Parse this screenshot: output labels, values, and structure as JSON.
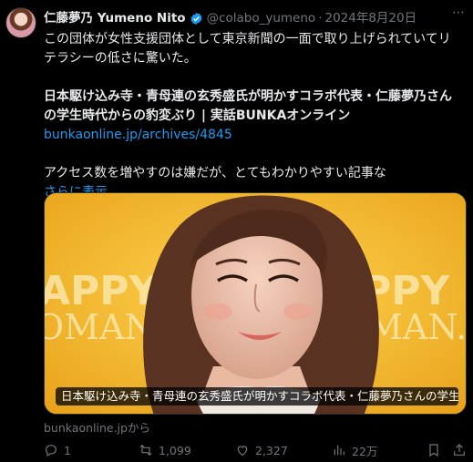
{
  "author": {
    "display_name": "仁藤夢乃 Yumeno Nito",
    "handle": "@colabo_yumeno",
    "separator": "·",
    "date": "2024年8月20日"
  },
  "post": {
    "line1": "この団体が女性支援団体として東京新聞の一面で取り上げられていてリテラシーの低さに驚いた。",
    "headline": "日本駆け込み寺・青母連の玄秀盛氏が明かすコラボ代表・仁藤夢乃さんの学生時代からの豹変ぶり | 実話BUNKAオンライン",
    "link": "bunkaonline.jp/archives/4845",
    "line2": "アクセス数を増やすのは嫌だが、とてもわかりやすい記事な",
    "show_more": "さらに表示"
  },
  "card": {
    "caption": "日本駆け込み寺・青母連の玄秀盛氏が明かすコラボ代表・仁藤夢乃さんの学生...",
    "source": "bunkaonline.jpから",
    "backdrop_text_1": "APPY",
    "backdrop_text_2": "OMAN.",
    "backdrop_text_3": "PPY",
    "backdrop_text_4": "MAN."
  },
  "actions": {
    "reply_count": "1",
    "repost_count": "1,099",
    "like_count": "2,327",
    "views_count": "22万"
  },
  "colors": {
    "accent": "#1d9bf0",
    "muted": "#71767b",
    "text": "#e7e9ea",
    "background": "#000000",
    "card_yellow": "#f0b82a"
  },
  "icons": [
    "verified-badge-icon",
    "more-icon",
    "reply-icon",
    "repost-icon",
    "like-icon",
    "views-icon",
    "bookmark-icon",
    "share-icon"
  ]
}
